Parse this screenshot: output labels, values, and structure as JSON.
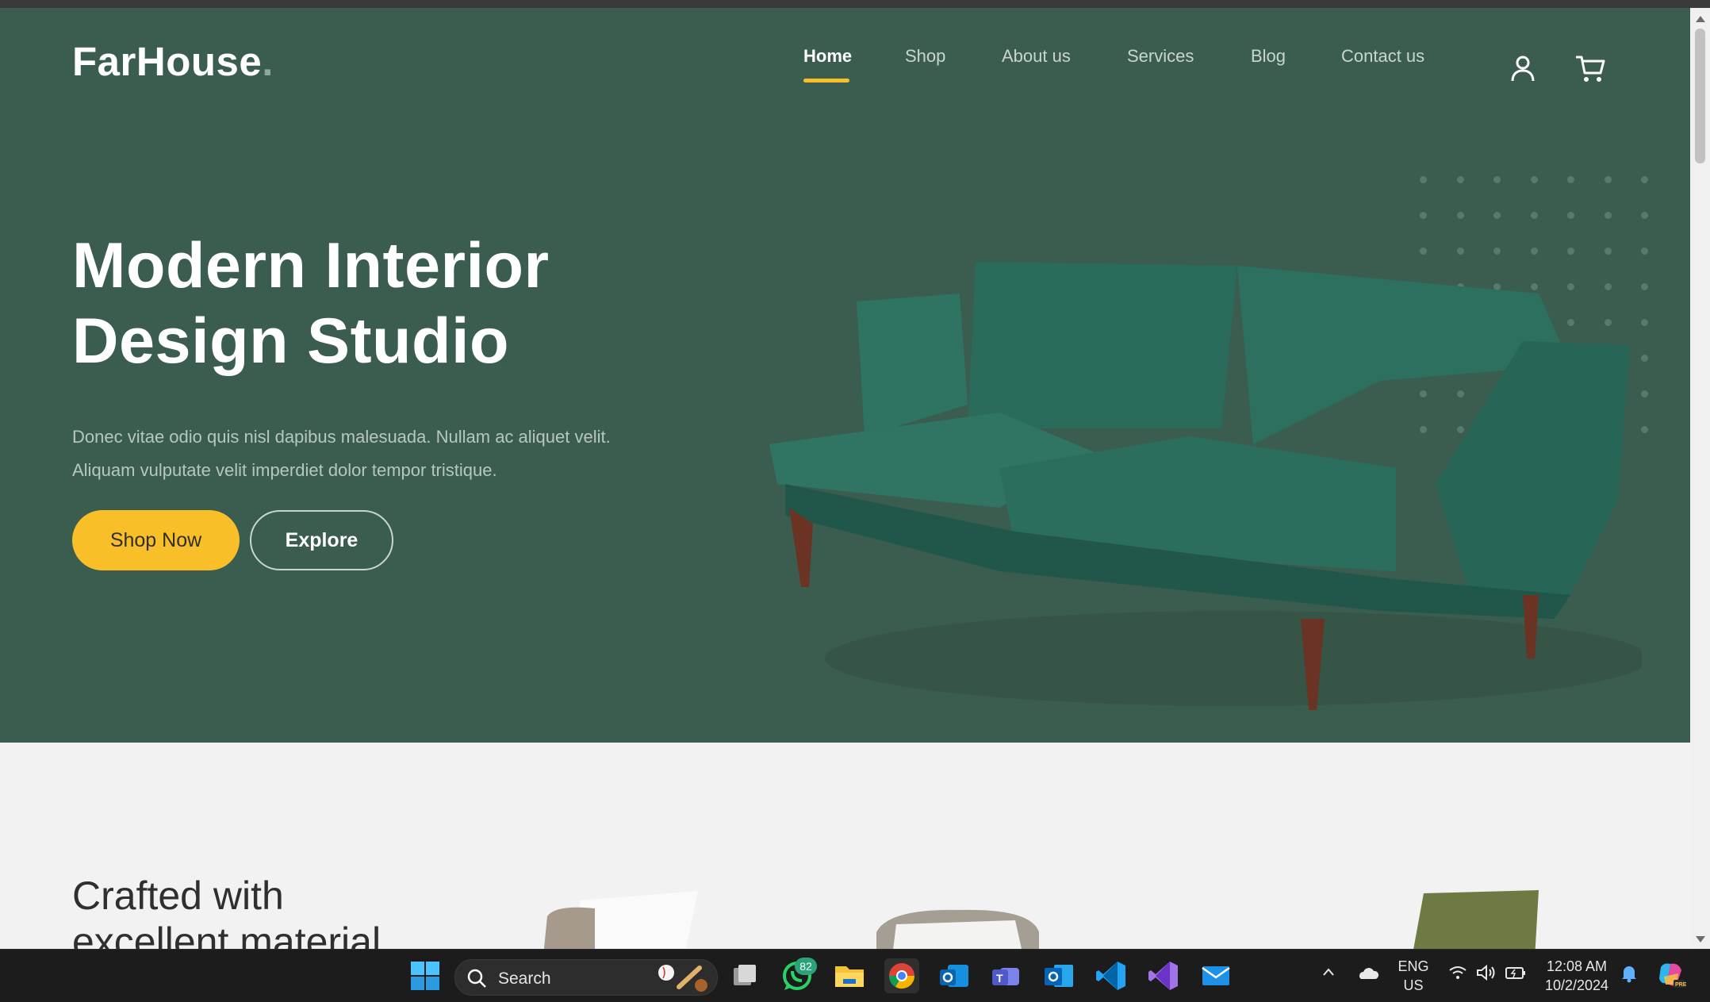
{
  "site": {
    "logo": "FarHouse",
    "logo_dot": ".",
    "nav": [
      {
        "label": "Home",
        "active": true
      },
      {
        "label": "Shop",
        "active": false
      },
      {
        "label": "About us",
        "active": false
      },
      {
        "label": "Services",
        "active": false
      },
      {
        "label": "Blog",
        "active": false
      },
      {
        "label": "Contact us",
        "active": false
      }
    ],
    "accent_color": "#f9bf29",
    "hero_bg": "#3b5d50",
    "hero": {
      "title_line1": "Modern Interior",
      "title_line2": "Design Studio",
      "subtitle": "Donec vitae odio quis nisl dapibus malesuada. Nullam ac aliquet velit. Aliquam vulputate velit imperdiet dolor tempor tristique.",
      "primary_button": "Shop Now",
      "secondary_button": "Explore"
    },
    "section2": {
      "title_line1": "Crafted with",
      "title_line2": "excellent material."
    }
  },
  "taskbar": {
    "search_placeholder": "Search",
    "whatsapp_badge": "82",
    "language_line1": "ENG",
    "language_line2": "US",
    "time": "12:08 AM",
    "date": "10/2/2024"
  }
}
